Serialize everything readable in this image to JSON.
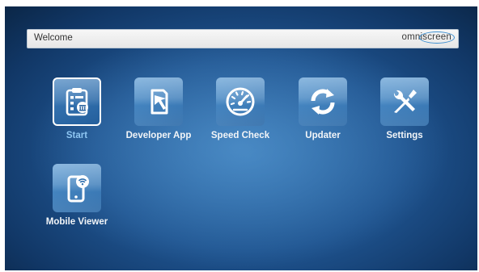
{
  "header": {
    "title": "Welcome",
    "brand": "omniscreen"
  },
  "apps": [
    {
      "label": "Start",
      "icon": "clipboard-checklist-icon",
      "selected": true
    },
    {
      "label": "Developer App",
      "icon": "developer-app-icon",
      "selected": false
    },
    {
      "label": "Speed Check",
      "icon": "speedometer-icon",
      "selected": false
    },
    {
      "label": "Updater",
      "icon": "refresh-icon",
      "selected": false
    },
    {
      "label": "Settings",
      "icon": "wrench-screwdriver-icon",
      "selected": false
    },
    {
      "label": "Mobile Viewer",
      "icon": "mobile-wifi-icon",
      "selected": false
    }
  ],
  "colors": {
    "background": "#1f5490",
    "tile": "#3f7fbd",
    "selected_label": "#8ec6f2",
    "header_bar": "#f0f0f0",
    "brand_ring": "#3d8fd0"
  }
}
